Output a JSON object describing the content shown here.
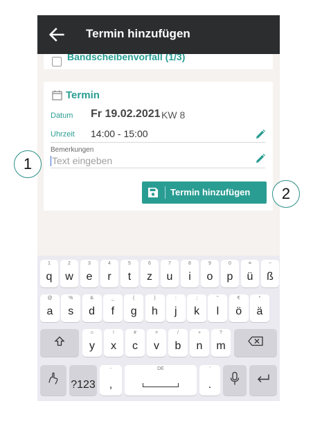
{
  "appbar": {
    "title": "Termin hinzufügen",
    "back_icon": "arrow-left-icon"
  },
  "previous_card": {
    "label": "Bandscheibenvorfall (1/3)"
  },
  "termin": {
    "title": "Termin",
    "datum_label": "Datum",
    "datum_value": "Fr 19.02.2021",
    "kw_value": "KW 8",
    "uhrzeit_label": "Uhrzeit",
    "uhrzeit_value": "14:00 - 15:00",
    "bemerkungen_label": "Bemerkungen",
    "bemerkungen_placeholder": "Text eingeben",
    "save_label": "Termin hinzufügen"
  },
  "callouts": {
    "one": "1",
    "two": "2"
  },
  "keyboard": {
    "row1": [
      {
        "k": "q",
        "a": "1"
      },
      {
        "k": "w",
        "a": "2"
      },
      {
        "k": "e",
        "a": "3"
      },
      {
        "k": "r",
        "a": "4"
      },
      {
        "k": "t",
        "a": "5"
      },
      {
        "k": "z",
        "a": "6"
      },
      {
        "k": "u",
        "a": "7"
      },
      {
        "k": "i",
        "a": "8"
      },
      {
        "k": "o",
        "a": "9"
      },
      {
        "k": "p",
        "a": "0"
      },
      {
        "k": "ü",
        "a": "¤"
      },
      {
        "k": "ß",
        "a": "~"
      }
    ],
    "row2": [
      {
        "k": "a",
        "a": "@"
      },
      {
        "k": "s",
        "a": "%"
      },
      {
        "k": "d",
        "a": "&"
      },
      {
        "k": "f",
        "a": "_"
      },
      {
        "k": "g",
        "a": "("
      },
      {
        "k": "h",
        "a": ")"
      },
      {
        "k": "j",
        "a": ":"
      },
      {
        "k": "k",
        "a": ";"
      },
      {
        "k": "l",
        "a": "\""
      },
      {
        "k": "ö",
        "a": "€"
      },
      {
        "k": "ä",
        "a": "*"
      }
    ],
    "row3": [
      {
        "k": "y",
        "a": "☺"
      },
      {
        "k": "x",
        "a": "!"
      },
      {
        "k": "c",
        "a": "#"
      },
      {
        "k": "v",
        "a": "="
      },
      {
        "k": "b",
        "a": "/"
      },
      {
        "k": "n",
        "a": "+"
      },
      {
        "k": "m",
        "a": "?"
      }
    ],
    "symbols_label": "?123",
    "comma_label": ",",
    "comma_alt": "-",
    "space_label": "DE",
    "period_label": ".",
    "period_alt": "'",
    "accent": "#2a9d93"
  }
}
